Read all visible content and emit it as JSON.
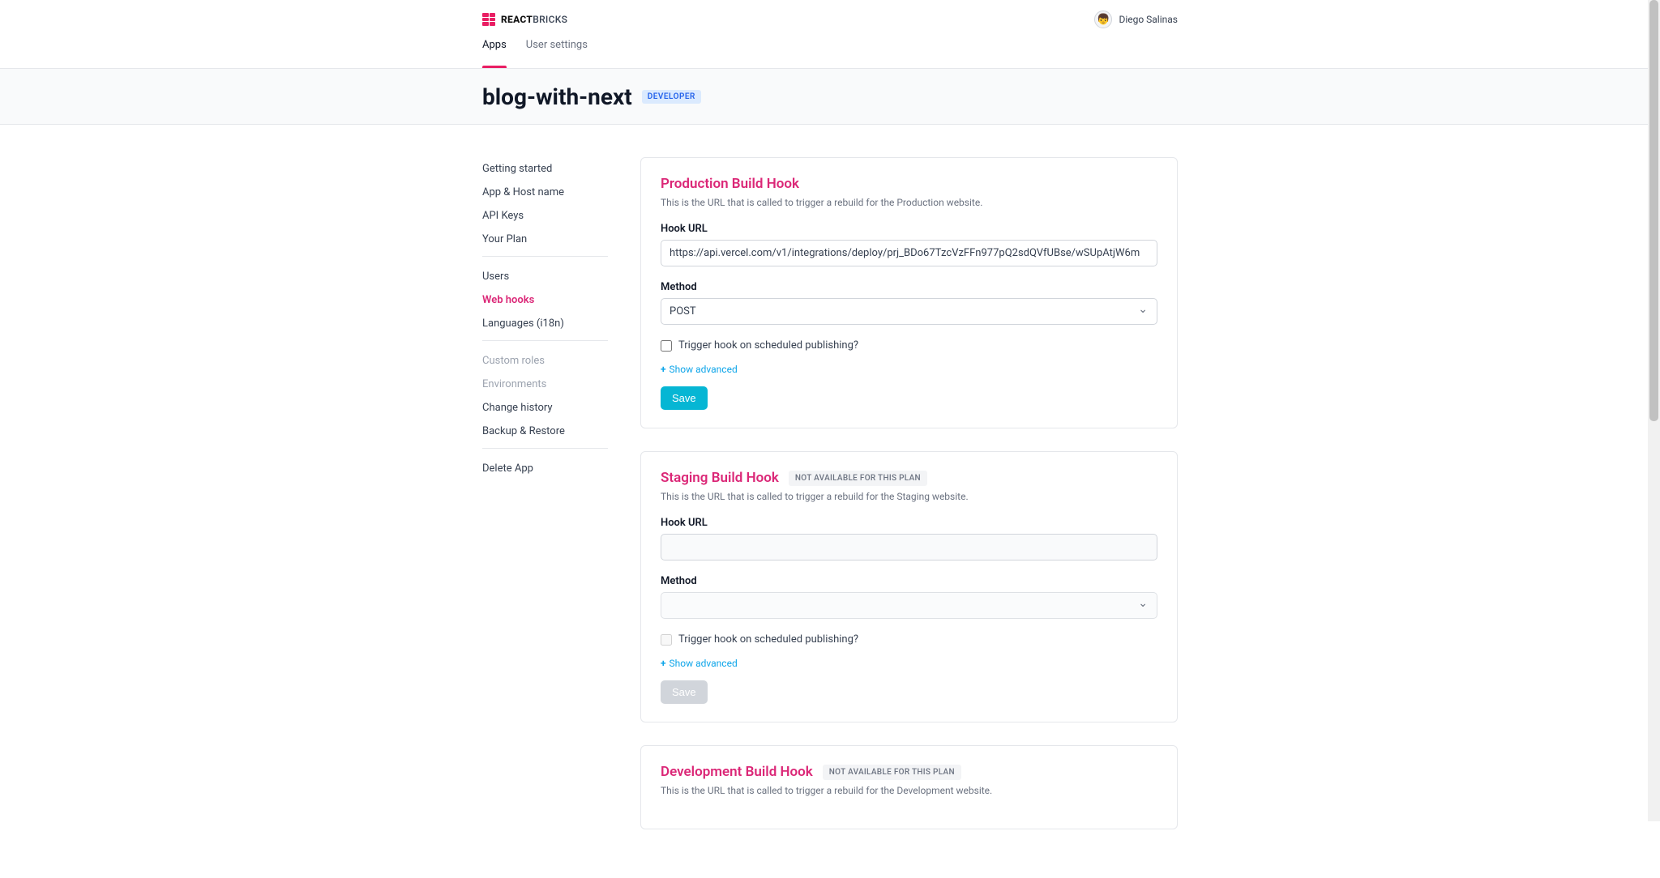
{
  "brand": {
    "name_strong": "REACT",
    "name_light": "BRICKS"
  },
  "user": {
    "name": "Diego Salinas",
    "avatar_emoji": "👦"
  },
  "nav": {
    "apps": "Apps",
    "user_settings": "User settings"
  },
  "page": {
    "title": "blog-with-next",
    "role_badge": "DEVELOPER"
  },
  "sidebar": {
    "group1": {
      "getting_started": "Getting started",
      "app_host": "App & Host name",
      "api_keys": "API Keys",
      "your_plan": "Your Plan"
    },
    "group2": {
      "users": "Users",
      "web_hooks": "Web hooks",
      "languages": "Languages (i18n)"
    },
    "group3": {
      "custom_roles": "Custom roles",
      "environments": "Environments",
      "change_history": "Change history",
      "backup_restore": "Backup & Restore"
    },
    "group4": {
      "delete_app": "Delete App"
    }
  },
  "common": {
    "hook_url_label": "Hook URL",
    "method_label": "Method",
    "trigger_checkbox": "Trigger hook on scheduled publishing?",
    "show_advanced": "Show advanced",
    "save": "Save",
    "na_badge": "NOT AVAILABLE FOR THIS PLAN"
  },
  "cards": {
    "prod": {
      "title": "Production Build Hook",
      "desc": "This is the URL that is called to trigger a rebuild for the Production website.",
      "url": "https://api.vercel.com/v1/integrations/deploy/prj_BDo67TzcVzFFn977pQ2sdQVfUBse/wSUpAtjW6m",
      "method": "POST"
    },
    "staging": {
      "title": "Staging Build Hook",
      "desc": "This is the URL that is called to trigger a rebuild for the Staging website.",
      "url": "",
      "method": ""
    },
    "dev": {
      "title": "Development Build Hook",
      "desc": "This is the URL that is called to trigger a rebuild for the Development website."
    }
  }
}
